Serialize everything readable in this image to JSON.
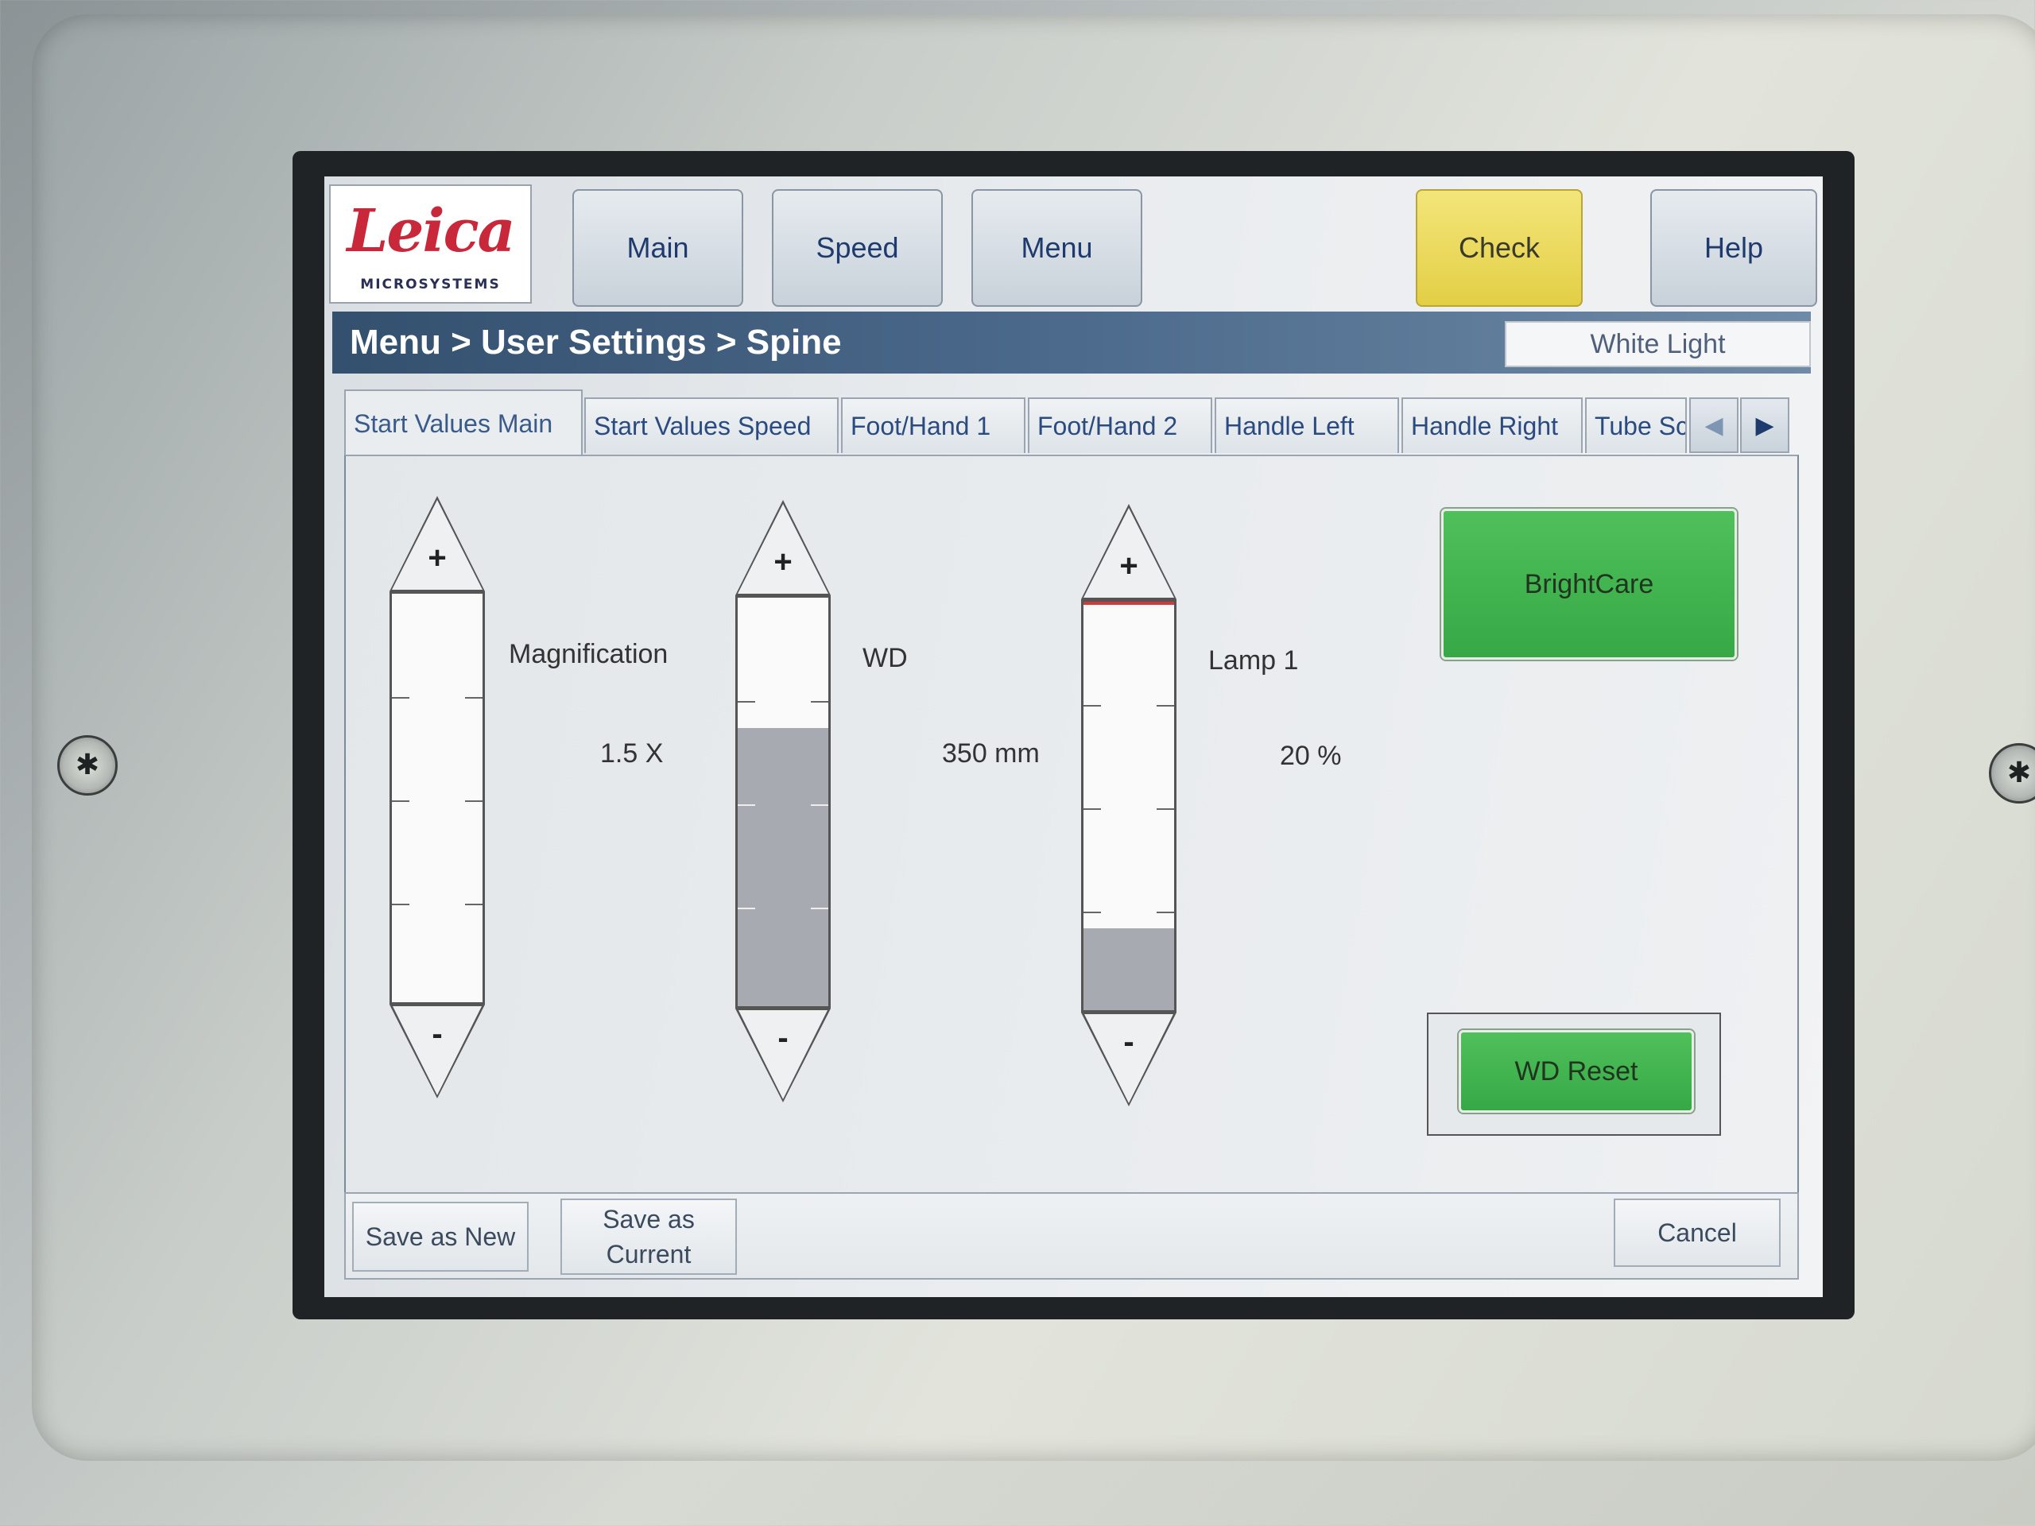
{
  "header": {
    "logo_word": "Leica",
    "logo_sub": "MICROSYSTEMS",
    "buttons": {
      "main": "Main",
      "speed": "Speed",
      "menu": "Menu",
      "check": "Check",
      "help": "Help"
    }
  },
  "breadcrumb": "Menu > User Settings > Spine",
  "mode_indicator": "White Light",
  "tabs": [
    {
      "label": "Start Values Main",
      "active": true
    },
    {
      "label": "Start Values Speed",
      "active": false
    },
    {
      "label": "Foot/Hand 1",
      "active": false
    },
    {
      "label": "Foot/Hand 2",
      "active": false
    },
    {
      "label": "Handle Left",
      "active": false
    },
    {
      "label": "Handle Right",
      "active": false
    },
    {
      "label": "Tube Sc",
      "active": false
    }
  ],
  "tab_scroll_icons": [
    "triangle-left-icon",
    "triangle-right-icon"
  ],
  "sliders": {
    "magnification": {
      "label": "Magnification",
      "value": "1.5 X",
      "fill_fraction": 0.0,
      "plus": "+",
      "minus": "-"
    },
    "wd": {
      "label": "WD",
      "value": "350 mm",
      "fill_fraction": 0.68,
      "plus": "+",
      "minus": "-"
    },
    "lamp1": {
      "label": "Lamp 1",
      "value": "20 %",
      "fill_fraction": 0.2,
      "plus": "+",
      "minus": "-"
    }
  },
  "actions": {
    "brightcare": "BrightCare",
    "wd_reset": "WD Reset"
  },
  "footer": {
    "save_new": "Save as New",
    "save_current_line1": "Save as",
    "save_current_line2": "Current",
    "cancel": "Cancel"
  },
  "colors": {
    "accent_green": "#3db34c",
    "check_yellow": "#ecd95e",
    "breadcrumb_blue": "#3e5b7c",
    "logo_red": "#c8283a"
  }
}
